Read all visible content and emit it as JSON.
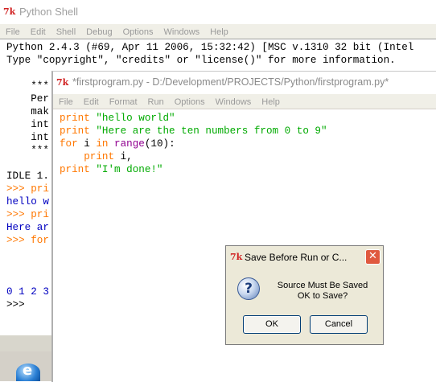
{
  "shell": {
    "title": "Python Shell",
    "menu": [
      "File",
      "Edit",
      "Shell",
      "Debug",
      "Options",
      "Windows",
      "Help"
    ],
    "lines": [
      {
        "text": "Python 2.4.3 (#69, Apr 11 2006, 15:32:42) [MSC v.1310 32 bit (Intel",
        "color": "black"
      },
      {
        "text": "Type \"copyright\", \"credits\" or \"license()\" for more information.",
        "color": "black"
      },
      {
        "text": "",
        "color": "black"
      },
      {
        "text": "    ***",
        "color": "black"
      },
      {
        "text": "    Per",
        "color": "black"
      },
      {
        "text": "    mak",
        "color": "black"
      },
      {
        "text": "    int",
        "color": "black"
      },
      {
        "text": "    int",
        "color": "black"
      },
      {
        "text": "    ***",
        "color": "black"
      },
      {
        "text": "",
        "color": "black"
      },
      {
        "text": "IDLE 1.",
        "color": "black"
      },
      {
        "text": ">>> pri",
        "color": "orange"
      },
      {
        "text": "hello w",
        "color": "blue"
      },
      {
        "text": ">>> pri",
        "color": "orange"
      },
      {
        "text": "Here ar",
        "color": "blue"
      },
      {
        "text": ">>> for",
        "color": "orange"
      },
      {
        "text": "",
        "color": "black"
      },
      {
        "text": "",
        "color": "black"
      },
      {
        "text": "",
        "color": "black"
      },
      {
        "text": "0 1 2 3",
        "color": "blue"
      },
      {
        "text": ">>>",
        "color": "black"
      }
    ]
  },
  "editor": {
    "title": "*firstprogram.py - D:/Development/PROJECTS/Python/firstprogram.py*",
    "menu": [
      "File",
      "Edit",
      "Format",
      "Run",
      "Options",
      "Windows",
      "Help"
    ],
    "code": [
      [
        {
          "t": "print ",
          "c": "orange"
        },
        {
          "t": "\"hello world\"",
          "c": "green"
        }
      ],
      [
        {
          "t": "print ",
          "c": "orange"
        },
        {
          "t": "\"Here are the ten numbers from 0 to 9\"",
          "c": "green"
        }
      ],
      [
        {
          "t": "for ",
          "c": "orange"
        },
        {
          "t": "i ",
          "c": "black"
        },
        {
          "t": "in ",
          "c": "orange"
        },
        {
          "t": "range",
          "c": "purple"
        },
        {
          "t": "(10):",
          "c": "black"
        }
      ],
      [
        {
          "t": "    print ",
          "c": "orange"
        },
        {
          "t": "i,",
          "c": "black"
        }
      ],
      [
        {
          "t": "print ",
          "c": "orange"
        },
        {
          "t": "\"I'm done!\"",
          "c": "green"
        }
      ]
    ]
  },
  "dialog": {
    "title": "Save Before Run or C...",
    "message_line1": "Source Must Be Saved",
    "message_line2": "OK to Save?",
    "ok_label": "OK",
    "cancel_label": "Cancel",
    "close_glyph": "✕",
    "question_glyph": "?"
  },
  "icons": {
    "tk_glyph": "7k"
  }
}
